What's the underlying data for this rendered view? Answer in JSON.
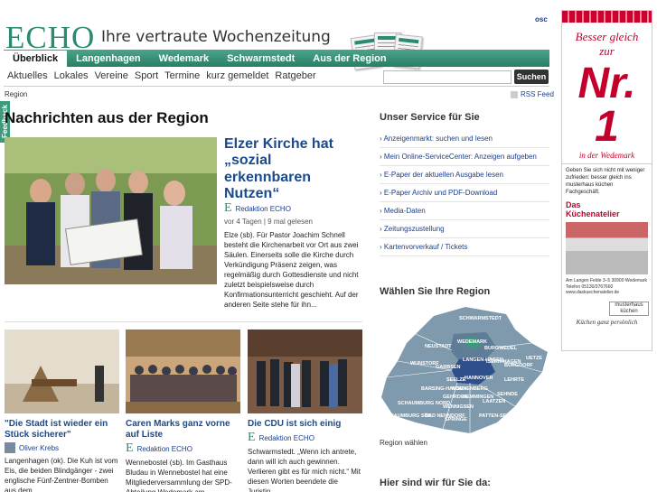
{
  "header": {
    "logo": "ECHO",
    "tagline": "Ihre vertraute Wochenzeitung",
    "osc": "osc",
    "nav": [
      "Überblick",
      "Langenhagen",
      "Wedemark",
      "Schwarmstedt",
      "Aus der Region"
    ],
    "subnav": [
      "Aktuelles",
      "Lokales",
      "Vereine",
      "Sport",
      "Termine",
      "kurz gemeldet",
      "Ratgeber"
    ],
    "search_placeholder": "",
    "search_button": "Suchen"
  },
  "feedback": "Feedback",
  "breadcrumb": "Region",
  "rss": "RSS Feed",
  "section_title": "Nachrichten aus der Region",
  "lead": {
    "title": "Elzer Kirche hat „sozial erkennbaren Nutzen“",
    "author": "Redaktion ECHO",
    "meta": "vor 4 Tagen | 9 mal gelesen",
    "text": "Elze (sb). Für Pastor Joachim Schnell besteht die Kirchenarbeit vor Ort aus zwei Säulen. Einerseits solle die Kirche durch Verkündigung Präsenz zeigen, was regelmäßig durch Gottesdienste und nicht zuletzt beispielsweise durch Konfirmationsunterricht geschieht. Auf der anderen Seite stehe für ihn..."
  },
  "cards": [
    {
      "title": "\"Die Stadt ist wieder ein Stück sicherer\"",
      "author": "Oliver Krebs",
      "text": "Langenhagen (ok). Die Kuh ist vom Eis, die beiden Blindgänger - zwei englische Fünf-Zentner-Bomben aus dem"
    },
    {
      "title": "Caren Marks ganz vorne auf Liste",
      "author": "Redaktion ECHO",
      "text": "Wennebostel (sb). Im Gasthaus Bludau in Wennebostel hat eine Mitgliederversammlung der SPD-Abteilung Wedemark am"
    },
    {
      "title": "Die CDU ist sich einig",
      "author": "Redaktion ECHO",
      "text": "Schwarmstedt. „Wenn ich antrete, dann will ich auch gewinnen. Verlieren gibt es für mich nicht.“ Mit diesen Worten beendete die Juristin"
    }
  ],
  "service": {
    "title": "Unser Service für Sie",
    "items": [
      "Anzeigenmarkt: suchen und lesen",
      "Mein Online-ServiceCenter: Anzeigen aufgeben",
      "E-Paper der aktuellen Ausgabe lesen",
      "E-Paper Archiv und PDF-Download",
      "Media-Daten",
      "Zeitungszustellung",
      "Kartenvorverkauf / Tickets"
    ]
  },
  "region": {
    "title": "Wählen Sie Ihre Region",
    "labels": [
      "SCHWARMSTEDT",
      "NEUSTADT",
      "WEDEMARK",
      "BURGWEDEL",
      "WUNSTORF",
      "GARBSEN",
      "LANGEN-HAGEN",
      "ISERN-HAGEN",
      "BURGDORF",
      "UETZE",
      "SEELZE",
      "HANNOVER",
      "LEHRTE",
      "BARSING-HAUSEN",
      "RONNENBERG",
      "SEHNDE",
      "GEHRDEN",
      "HEMMINGEN",
      "LAATZEN",
      "WENNIGSEN",
      "SCHAUMBURG NORD",
      "PATTEN-SEN",
      "SCHAUMBURG SÜD",
      "BAD NENNDORF",
      "SPRINGE"
    ],
    "link": "Region wählen"
  },
  "here_title": "Hier sind wir für Sie da:",
  "ad": {
    "slogan1": "Besser gleich",
    "slogan2": "zur",
    "nr": "Nr. 1",
    "sub": "in der Wedemark",
    "desc": "Geben Sie sich nicht mit weniger zufrieden: besser gleich ins musterhaus küchen Fachgeschäft.",
    "brand1": "Das",
    "brand2": "Küchenatelier",
    "addr": "Am Langen Felde 3–5 30900 Wedemark Telefon 05130/3767660 www.daskuechenatelier.de",
    "logo2": "musterhaus küchen",
    "foot": "Küchen ganz persönlich"
  },
  "colors": {
    "brand": "#2a8a72",
    "link": "#1a3f8c",
    "headline": "#1a4a8c",
    "ad_red": "#c3002b"
  }
}
